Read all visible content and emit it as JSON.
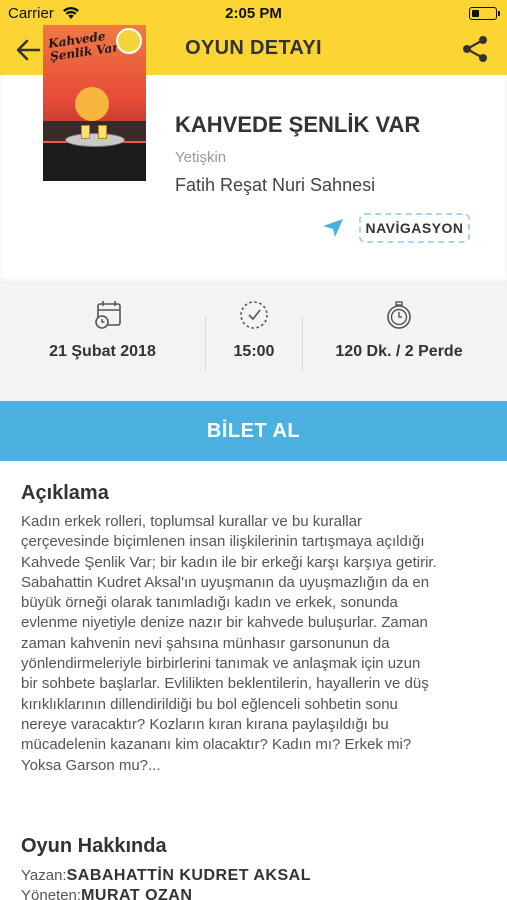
{
  "status_bar": {
    "carrier": "Carrier",
    "time": "2:05 PM",
    "wifi_icon": "wifi-icon",
    "battery_icon": "battery-icon"
  },
  "header": {
    "title": "OYUN DETAYI",
    "back_icon": "back-arrow-icon",
    "share_icon": "share-icon"
  },
  "colors": {
    "header_bg": "#fcd534",
    "accent_blue": "#4bb0e0",
    "nav_border": "#a9d4ec",
    "meta_bg": "#f3f3f3"
  },
  "play": {
    "poster_title": "Kahvede Şenlik Var",
    "title": "KAHVEDE ŞENLİK VAR",
    "category": "Yetişkin",
    "venue": "Fatih Reşat Nuri Sahnesi",
    "navigation_label": "NAVİGASYON",
    "navigation_icon": "location-arrow-icon"
  },
  "meta": {
    "date": "21 Şubat 2018",
    "time": "15:00",
    "duration": "120 Dk. / 2 Perde",
    "date_icon": "calendar-icon",
    "time_icon": "clock-icon",
    "duration_icon": "stopwatch-icon"
  },
  "ticket_button": "BİLET AL",
  "description": {
    "heading": "Açıklama",
    "lines": [
      "Kadın erkek rolleri, toplumsal kurallar ve bu kurallar",
      "çerçevesinde biçimlenen insan ilişkilerinin tartışmaya açıldığı",
      "Kahvede Şenlik Var; bir kadın ile bir erkeği karşı karşıya getirir.",
      "Sabahattin Kudret Aksal'ın uyuşmanın da uyuşmazlığın da en",
      "büyük örneği olarak tanımladığı kadın ve erkek, sonunda",
      "evlenme niyetiyle denize nazır bir kahvede buluşurlar. Zaman",
      "zaman kahvenin nevi şahsına münhasır garsonunun da",
      "yönlendirmeleriyle birbirlerini tanımak ve anlaşmak için uzun",
      "bir sohbete başlarlar. Evlilikten beklentilerin, hayallerin ve düş",
      "kırıklıklarının dillendirildiği bu bol eğlenceli sohbetin sonu",
      "nereye varacaktır? Kozların kıran kırana paylaşıldığı bu",
      "mücadelenin kazananı kim olacaktır? Kadın mı? Erkek mi?",
      "Yoksa Garson mu?..."
    ]
  },
  "about": {
    "heading": "Oyun Hakkında",
    "writer_label": "Yazan:",
    "writer": "SABAHATTİN KUDRET AKSAL",
    "director_label": "Yöneten:",
    "director": "MURAT OZAN"
  }
}
